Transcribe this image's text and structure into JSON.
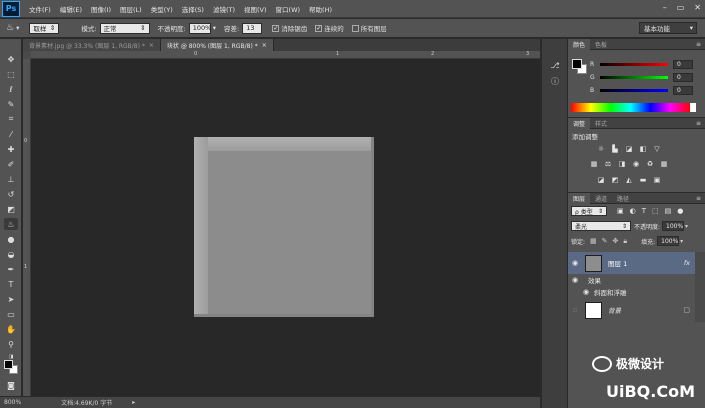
{
  "app": {
    "logo": "Ps"
  },
  "menubar": {
    "items": [
      "文件(F)",
      "编辑(E)",
      "图像(I)",
      "图层(L)",
      "类型(Y)",
      "选择(S)",
      "滤镜(T)",
      "视图(V)",
      "窗口(W)",
      "帮助(H)"
    ],
    "window_controls": [
      "–",
      "▭",
      "✕"
    ]
  },
  "options": {
    "sample_mode": "取样",
    "mode_label": "模式:",
    "mode_value": "正常",
    "opacity_label": "不透明度:",
    "opacity_value": "100%",
    "tolerance_label": "容差:",
    "tolerance_value": "13",
    "antialias_label": "消除锯齿",
    "contiguous_label": "连续的",
    "all_layers_label": "所有图层",
    "workspace": "基本功能"
  },
  "tabs": [
    {
      "label": "背景素材.jpg @ 33.3% (图层 1, RGB/8) *",
      "close": "×"
    },
    {
      "label": "块状 @ 800% (图层 1, RGB/8) *",
      "close": "×"
    }
  ],
  "rulers": {
    "top": [
      "0",
      "1",
      "2",
      "3"
    ],
    "left": [
      "0",
      "1"
    ]
  },
  "status": {
    "zoom": "800%",
    "doc_info": "文档:4.69K/0 字节"
  },
  "color_panel": {
    "tabs": [
      "颜色",
      "色板"
    ],
    "channels": [
      {
        "label": "R",
        "value": "0"
      },
      {
        "label": "G",
        "value": "0"
      },
      {
        "label": "B",
        "value": "0"
      }
    ]
  },
  "adjustments_panel": {
    "tabs": [
      "调整",
      "样式"
    ],
    "title": "添加调整"
  },
  "layers_panel": {
    "tabs": [
      "图层",
      "通道",
      "路径"
    ],
    "filter": "ρ 类型",
    "blend_mode": "柔光",
    "opacity_label": "不透明度:",
    "opacity_value": "100%",
    "lock_label": "锁定:",
    "fill_label": "填充:",
    "fill_value": "100%",
    "layers": [
      {
        "name": "图层 1",
        "fx": "fx"
      },
      {
        "name": "效果"
      },
      {
        "name": "斜面和浮雕"
      },
      {
        "name": "背景"
      }
    ]
  },
  "watermark": {
    "title": "极微设计",
    "url": "UiBQ.CoM"
  },
  "colors": {
    "chrome": "#535353",
    "canvas_bg": "#282828",
    "doc_fill": "#8d8d8d",
    "selected_layer": "#5a6a85",
    "accent": "#31a8ff"
  }
}
